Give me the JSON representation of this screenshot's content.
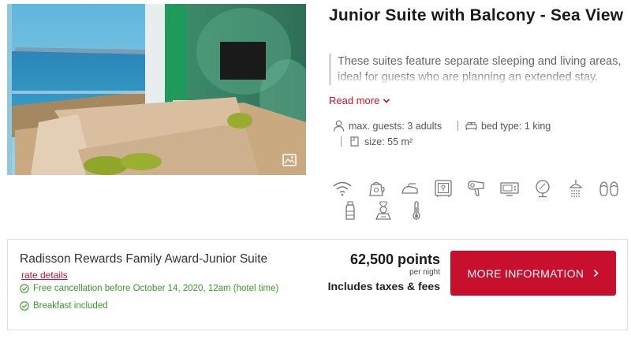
{
  "room": {
    "title": "Junior Suite with Balcony - Sea View",
    "description": "These suites feature separate sleeping and living areas, ideal for guests who are planning an extended stay.",
    "read_more": "Read more",
    "specs": {
      "guests": "max. guests: 3 adults",
      "bed": "bed type: 1 king",
      "size": "size: 55 m²"
    },
    "amenities": [
      "wifi-icon",
      "kettle-icon",
      "iron-icon",
      "safe-icon",
      "hairdryer-icon",
      "tv-icon",
      "mirror-icon",
      "shower-icon",
      "slippers-icon",
      "toiletries-icon",
      "minibar-icon",
      "thermometer-icon"
    ]
  },
  "rate": {
    "name": "Radisson Rewards Family Award-Junior Suite",
    "details_link": "rate details",
    "perks": [
      "Free cancellation before October 14, 2020, 12am (hotel time)",
      "Breakfast included"
    ],
    "points": "62,500 points",
    "per_night": "per night",
    "taxes": "Includes taxes & fees",
    "button_label": "MORE INFORMATION"
  },
  "colors": {
    "brand_red": "#c8102e",
    "perk_green": "#3a9a2a"
  }
}
